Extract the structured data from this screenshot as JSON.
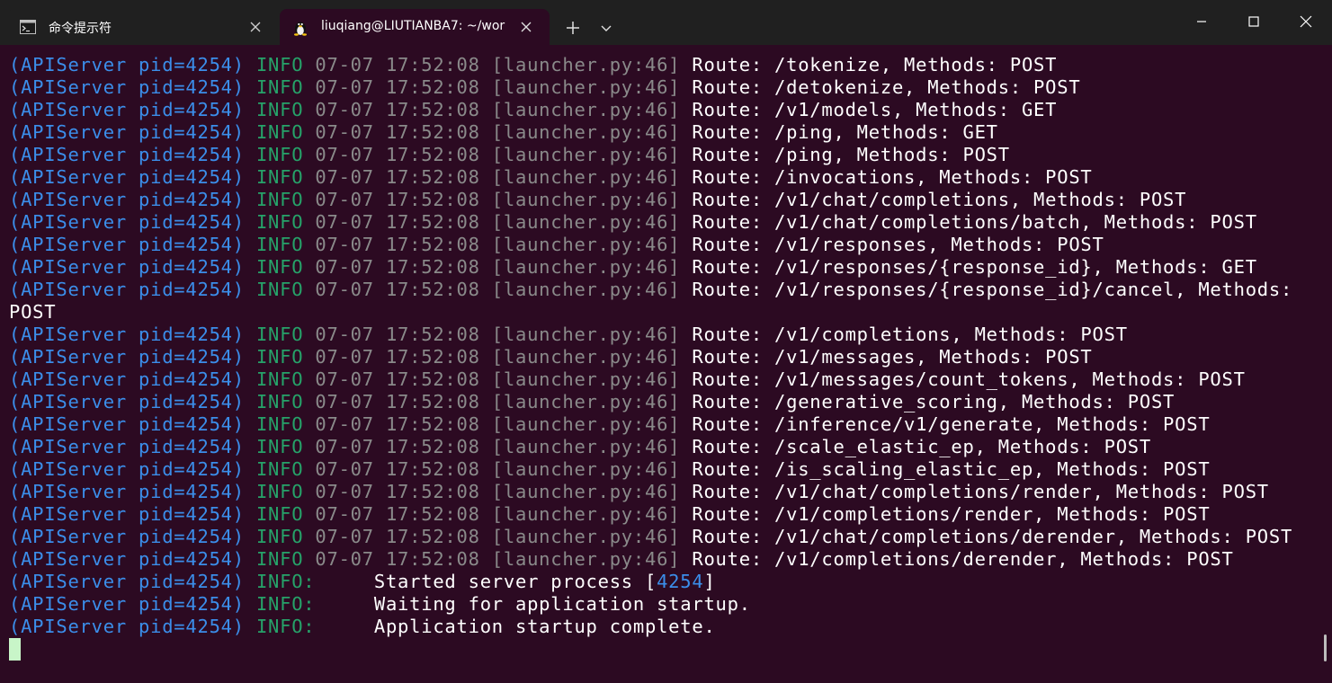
{
  "tabs": [
    {
      "title": "命令提示符",
      "icon": "cmd-icon"
    },
    {
      "title": "liuqiang@LIUTIANBA7: ~/wor",
      "icon": "linux-penguin-icon",
      "active": true
    }
  ],
  "toolbar": {
    "new_tab_icon": "+",
    "dropdown_icon": "⌄"
  },
  "window_controls": {
    "minimize": "minimize-icon",
    "maximize": "maximize-icon",
    "close": "close-icon"
  },
  "colors": {
    "background": "#2c0a22",
    "titlebar": "#202020",
    "process_tag": "#3b8eea",
    "info": "#26a269",
    "timestamp": "#8a8a8a",
    "message": "#ffffff"
  },
  "log": {
    "process": "(APIServer pid=4254)",
    "level": "INFO",
    "timestamp": "07-07 17:52:08",
    "source": "[launcher.py:46]",
    "route_lines": [
      "Route: /tokenize, Methods: POST",
      "Route: /detokenize, Methods: POST",
      "Route: /v1/models, Methods: GET",
      "Route: /ping, Methods: GET",
      "Route: /ping, Methods: POST",
      "Route: /invocations, Methods: POST",
      "Route: /v1/chat/completions, Methods: POST",
      "Route: /v1/chat/completions/batch, Methods: POST",
      "Route: /v1/responses, Methods: POST",
      "Route: /v1/responses/{response_id}, Methods: GET",
      "Route: /v1/responses/{response_id}/cancel, Methods:",
      "Route: /v1/completions, Methods: POST",
      "Route: /v1/messages, Methods: POST",
      "Route: /v1/messages/count_tokens, Methods: POST",
      "Route: /generative_scoring, Methods: POST",
      "Route: /inference/v1/generate, Methods: POST",
      "Route: /scale_elastic_ep, Methods: POST",
      "Route: /is_scaling_elastic_ep, Methods: POST",
      "Route: /v1/chat/completions/render, Methods: POST",
      "Route: /v1/completions/render, Methods: POST",
      "Route: /v1/chat/completions/derender, Methods: POST",
      "Route: /v1/completions/derender, Methods: POST"
    ],
    "wrap_line": "POST",
    "wrap_after_index": 10,
    "status_level": "INFO:",
    "status_lines": [
      {
        "text": "Started server process [",
        "pid": "4254",
        "suffix": "]"
      },
      {
        "text": "Waiting for application startup."
      },
      {
        "text": "Application startup complete."
      }
    ]
  }
}
